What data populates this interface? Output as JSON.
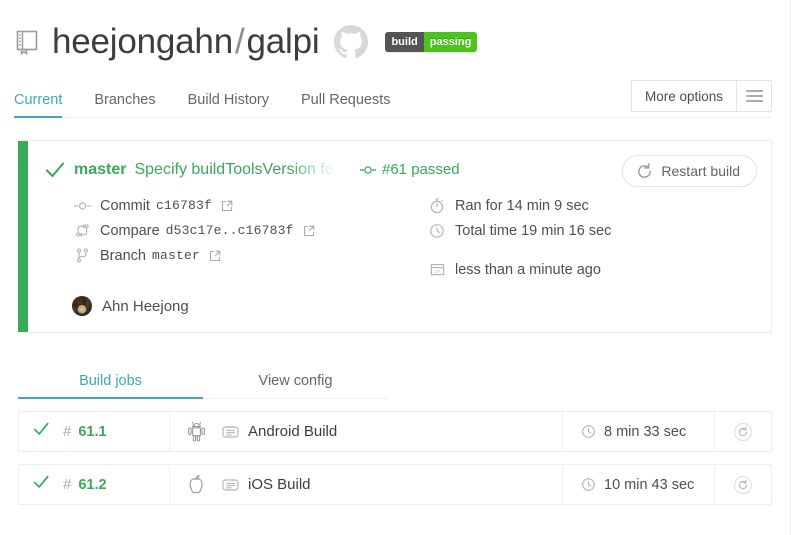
{
  "header": {
    "owner": "heejongahn",
    "separator": "/",
    "repo": "galpi",
    "repo_icon": "repository-book-icon",
    "provider_icon": "github-octocat-icon",
    "badge": {
      "left_label": "build",
      "right_label": "passing",
      "left_color": "#555555",
      "right_color": "#4bc51d"
    }
  },
  "nav": {
    "tabs": [
      {
        "label": "Current",
        "active": true
      },
      {
        "label": "Branches",
        "active": false
      },
      {
        "label": "Build History",
        "active": false
      },
      {
        "label": "Pull Requests",
        "active": false
      }
    ],
    "more_options_label": "More options",
    "menu_icon": "hamburger-icon",
    "accent_color": "#3eaaaf"
  },
  "build": {
    "status": "passed",
    "status_icon": "check-icon",
    "status_color": "#39aa56",
    "branch": "master",
    "commit_message": "Specify buildToolsVersion for android b",
    "build_number_label": "#61 passed",
    "build_number_icon": "commit-node-icon",
    "restart_label": "Restart build",
    "restart_icon": "restart-circular-arrow-icon",
    "details": [
      {
        "icon": "commit-node-icon",
        "label": "Commit",
        "value": "c16783f",
        "link_icon": "external-link-icon"
      },
      {
        "icon": "compare-icon",
        "label": "Compare",
        "value": "d53c17e..c16783f",
        "link_icon": "external-link-icon"
      },
      {
        "icon": "branch-icon",
        "label": "Branch",
        "value": "master",
        "link_icon": "external-link-icon"
      }
    ],
    "timing": [
      {
        "icon": "stopwatch-icon",
        "text": "Ran for 14 min 9 sec"
      },
      {
        "icon": "clock-icon",
        "text": "Total time 19 min 16 sec"
      },
      {
        "icon": "calendar-icon",
        "text": "less than a minute ago"
      }
    ],
    "author": {
      "name": "Ahn Heejong",
      "avatar_icon": "avatar"
    }
  },
  "jobs_section": {
    "tabs": [
      {
        "label": "Build jobs",
        "active": true
      },
      {
        "label": "View config",
        "active": false
      }
    ],
    "rows": [
      {
        "status_icon": "check-icon",
        "hash": "#",
        "id": "61.1",
        "os_icon": "android-icon",
        "config_icon": "config-list-icon",
        "config": "Android Build",
        "duration_icon": "clock-icon",
        "duration": "8 min 33 sec",
        "restart_icon": "restart-circular-arrow-icon"
      },
      {
        "status_icon": "check-icon",
        "hash": "#",
        "id": "61.2",
        "os_icon": "apple-icon",
        "config_icon": "config-list-icon",
        "config": "iOS Build",
        "duration_icon": "clock-icon",
        "duration": "10 min 43 sec",
        "restart_icon": "restart-circular-arrow-icon"
      }
    ]
  }
}
